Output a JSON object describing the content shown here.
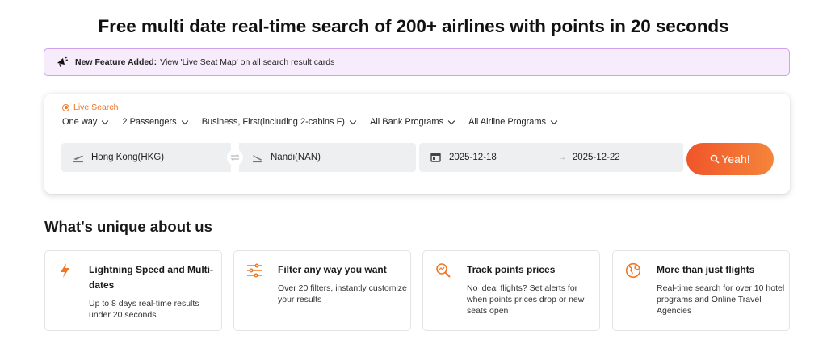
{
  "headline": {
    "part1_bold": "Free",
    "part2": " multi date ",
    "part3_bold": "real-time",
    "part4": " search of ",
    "part5_bold": "200+ airlines with points",
    "part6": " in 20 seconds"
  },
  "banner": {
    "icon": "megaphone-icon",
    "feature_label": "New Feature Added:",
    "text": "View 'Live Seat Map' on all search result cards"
  },
  "search": {
    "live_label": "Live Search",
    "trip_type": "One way",
    "passengers": "2 Passengers",
    "cabin": "Business, First(including 2-cabins F)",
    "bank_programs": "All Bank Programs",
    "airline_programs": "All Airline Programs",
    "from": "Hong Kong(HKG)",
    "to": "Nandi(NAN)",
    "depart_date": "2025-12-18",
    "arrow": "→",
    "return_date": "2025-12-22",
    "submit_label": "Yeah!"
  },
  "colors": {
    "accent": "#f07624",
    "button_start": "#f0552a",
    "button_end": "#f5853a",
    "banner_bg": "#f6ecfc",
    "banner_border": "#cfa3ec"
  },
  "unique": {
    "title": "What's unique about us",
    "cards": [
      {
        "icon": "lightning-icon",
        "title": "Lightning Speed and Multi-dates",
        "desc": "Up to 8 days real-time results under 20 seconds"
      },
      {
        "icon": "filter-sliders-icon",
        "title": "Filter any way you want",
        "desc": "Over 20 filters, instantly customize your results"
      },
      {
        "icon": "price-track-icon",
        "title": "Track points prices",
        "desc": "No ideal flights? Set alerts for when points prices drop or new seats open"
      },
      {
        "icon": "globe-icon",
        "title": "More than just flights",
        "desc": "Real-time search for over 10 hotel programs and Online Travel Agencies"
      }
    ]
  }
}
